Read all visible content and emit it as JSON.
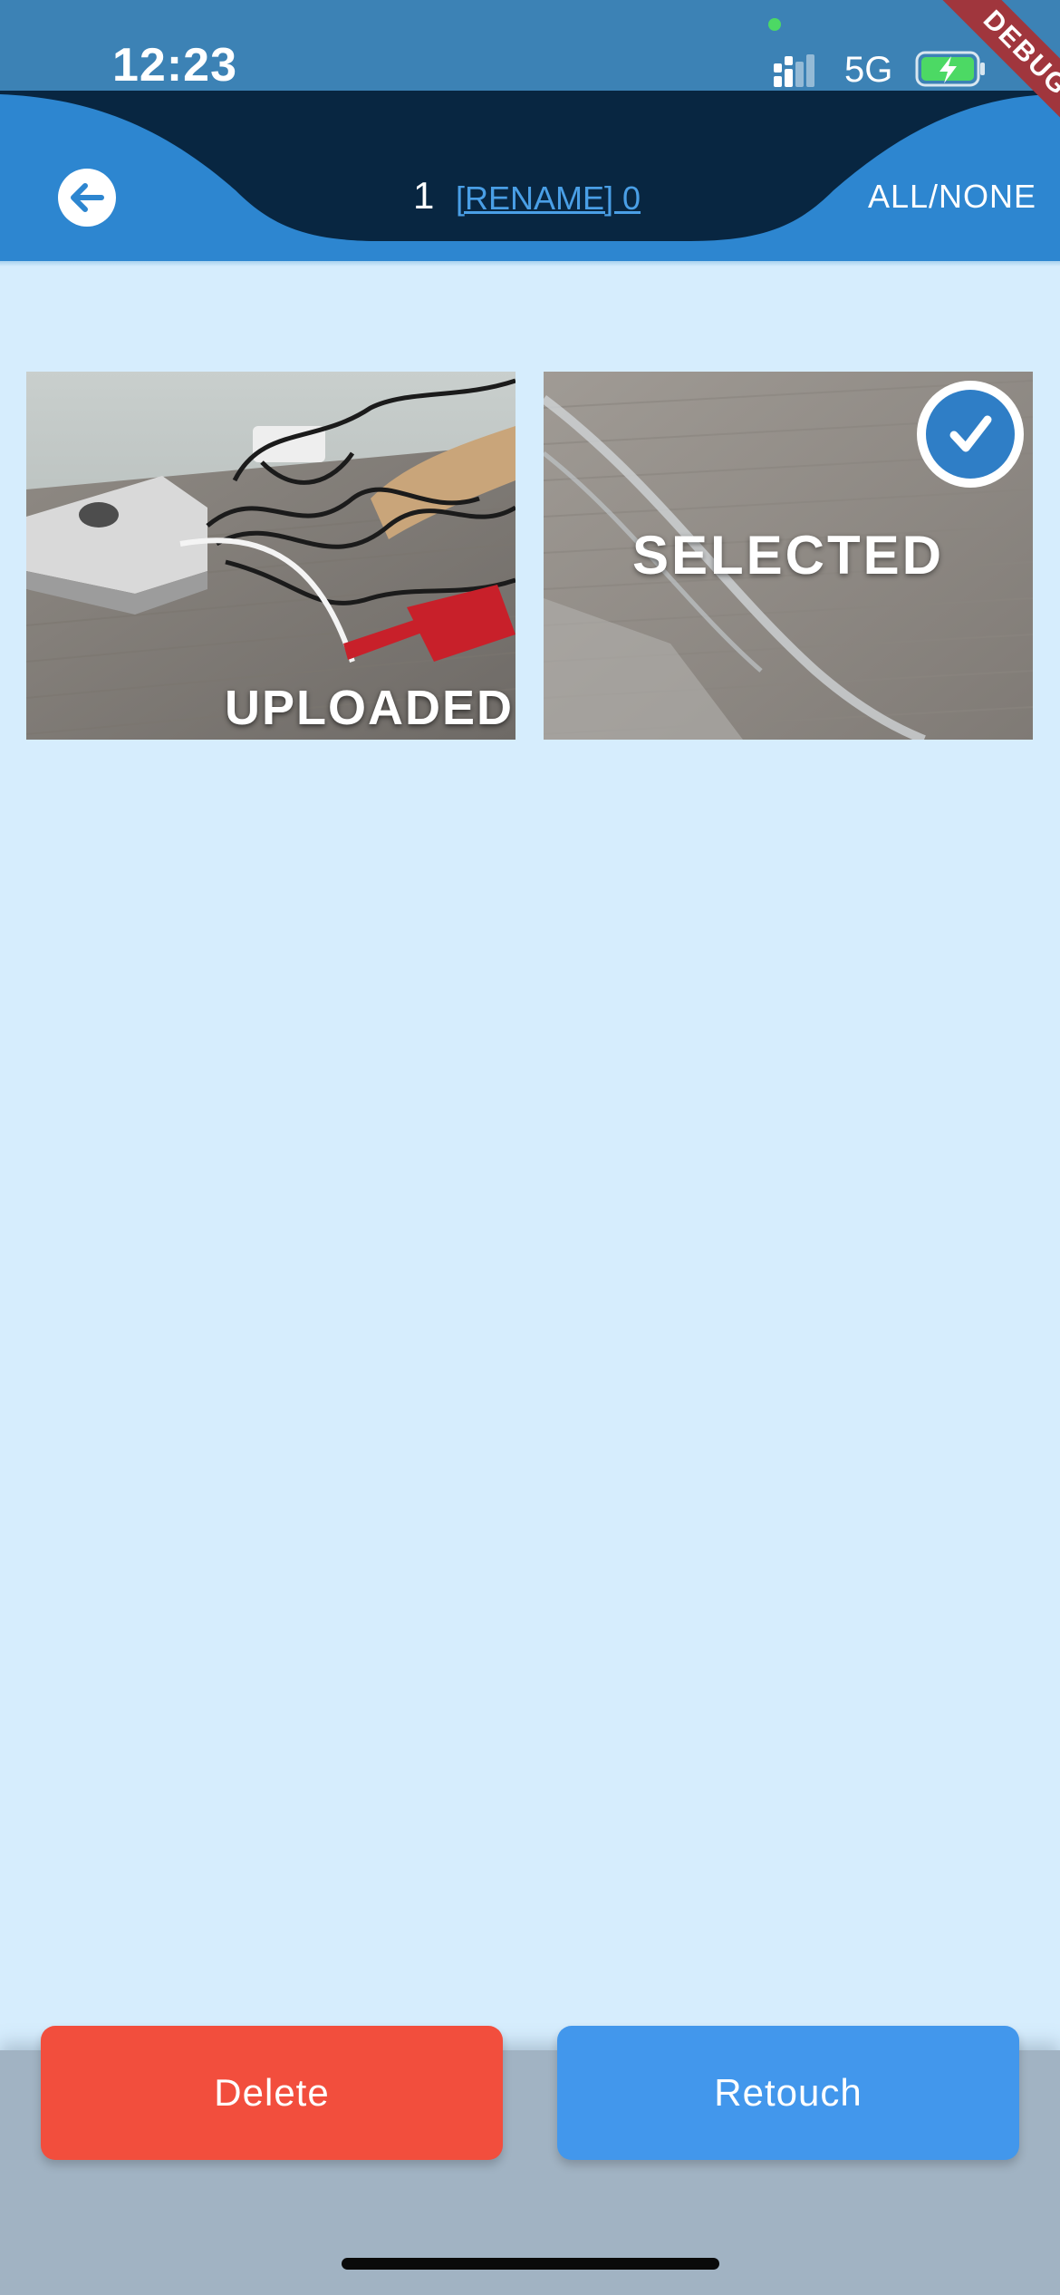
{
  "status_bar": {
    "time": "12:23",
    "network": "5G",
    "debug_banner": "DEBUG",
    "icons": [
      "signal-icon",
      "battery-charging-icon"
    ]
  },
  "header": {
    "count": "1",
    "rename_link": "[RENAME] 0",
    "select_toggle": "ALL/NONE",
    "icons": [
      "back-arrow-icon"
    ]
  },
  "photos": [
    {
      "label": "UPLOADED",
      "state": "uploaded"
    },
    {
      "label": "SELECTED",
      "state": "selected",
      "icons": [
        "checkmark-icon"
      ]
    }
  ],
  "actions": {
    "delete_label": "Delete",
    "retouch_label": "Retouch"
  },
  "colors": {
    "background": "#d6edfd",
    "status_bar": "#3c82b5",
    "header": "#2d86d0",
    "header_wave": "#082641",
    "delete": "#f24e3d",
    "retouch": "#4297ec",
    "bottom_bar": "#a1b3c3",
    "debug_banner": "#a0363d"
  }
}
